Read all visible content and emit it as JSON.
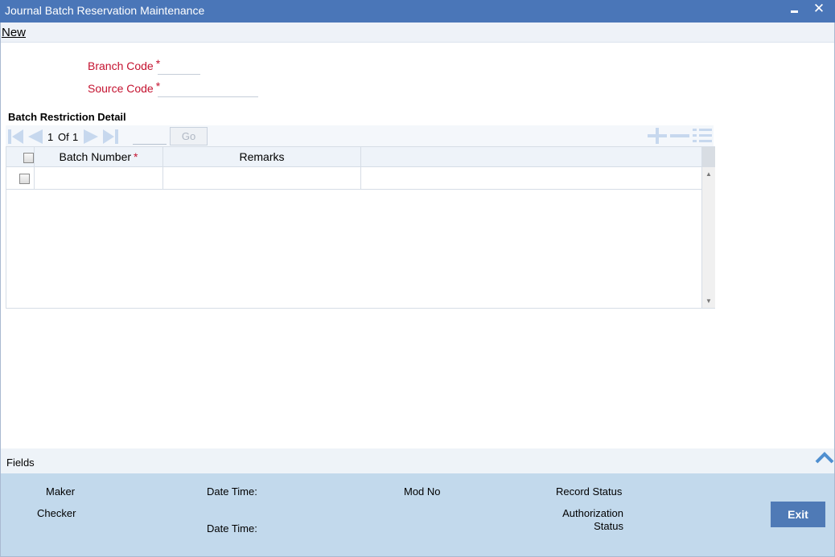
{
  "window": {
    "title": "Journal Batch Reservation Maintenance"
  },
  "toolbar": {
    "new_label": "New"
  },
  "form": {
    "branch_code": {
      "label": "Branch Code",
      "required": "*",
      "value": ""
    },
    "source_code": {
      "label": "Source Code",
      "required": "*",
      "value": ""
    }
  },
  "batch_restriction": {
    "title": "Batch Restriction Detail",
    "pagination": {
      "current": "1",
      "of_label": "Of",
      "total": "1",
      "goto_value": "",
      "go_label": "Go"
    },
    "columns": [
      {
        "label": "Batch Number",
        "required": "*"
      },
      {
        "label": "Remarks"
      }
    ],
    "rows": [
      {
        "batch_number": "",
        "remarks": ""
      }
    ]
  },
  "fields_bar": {
    "label": "Fields"
  },
  "audit": {
    "maker": "Maker",
    "checker": "Checker",
    "date_time_1": "Date Time:",
    "date_time_2": "Date Time:",
    "mod_no": "Mod No",
    "record_status": "Record Status",
    "authorization_status_line1": "Authorization",
    "authorization_status_line2": "Status",
    "exit_label": "Exit"
  },
  "colors": {
    "titlebar": "#4a76b8",
    "required_label": "#c4122f",
    "footer": "#c2d9ec",
    "exit_button": "#4f7ab6"
  },
  "icons": {
    "first_page": "first-page-icon",
    "prev_page": "previous-page-icon",
    "next_page": "next-page-icon",
    "last_page": "last-page-icon",
    "add_row": "plus-icon",
    "delete_row": "minus-icon",
    "single_record": "list-icon",
    "collapse": "chevron-up-icon"
  }
}
